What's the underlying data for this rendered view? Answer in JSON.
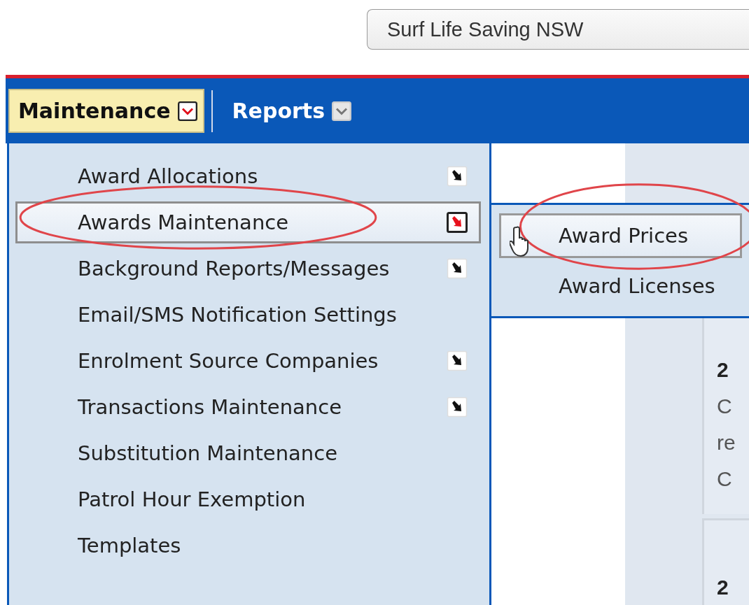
{
  "organisation_select": {
    "value": "Surf Life Saving NSW"
  },
  "nav": [
    {
      "label": "Maintenance",
      "selected": true
    },
    {
      "label": "Reports",
      "selected": false
    }
  ],
  "menu": [
    {
      "label": "Award Allocations",
      "has_submenu": true,
      "selected": false,
      "circled": false
    },
    {
      "label": "Awards Maintenance",
      "has_submenu": true,
      "selected": true,
      "circled": true
    },
    {
      "label": "Background Reports/Messages",
      "has_submenu": true,
      "selected": false,
      "circled": false
    },
    {
      "label": "Email/SMS Notification Settings",
      "has_submenu": false,
      "selected": false,
      "circled": false
    },
    {
      "label": "Enrolment Source Companies",
      "has_submenu": true,
      "selected": false,
      "circled": false
    },
    {
      "label": "Transactions Maintenance",
      "has_submenu": true,
      "selected": false,
      "circled": false
    },
    {
      "label": "Substitution Maintenance",
      "has_submenu": false,
      "selected": false,
      "circled": false
    },
    {
      "label": "Patrol Hour Exemption",
      "has_submenu": false,
      "selected": false,
      "circled": false
    },
    {
      "label": "Templates",
      "has_submenu": false,
      "selected": false,
      "circled": false
    }
  ],
  "submenu": [
    {
      "label": "Award Prices",
      "selected": true,
      "circled": true
    },
    {
      "label": "Award Licenses",
      "selected": false,
      "circled": false
    }
  ],
  "background_cards": [
    {
      "lines": [
        "2",
        "C",
        "re",
        "C"
      ]
    },
    {
      "lines": [
        "2"
      ]
    }
  ]
}
